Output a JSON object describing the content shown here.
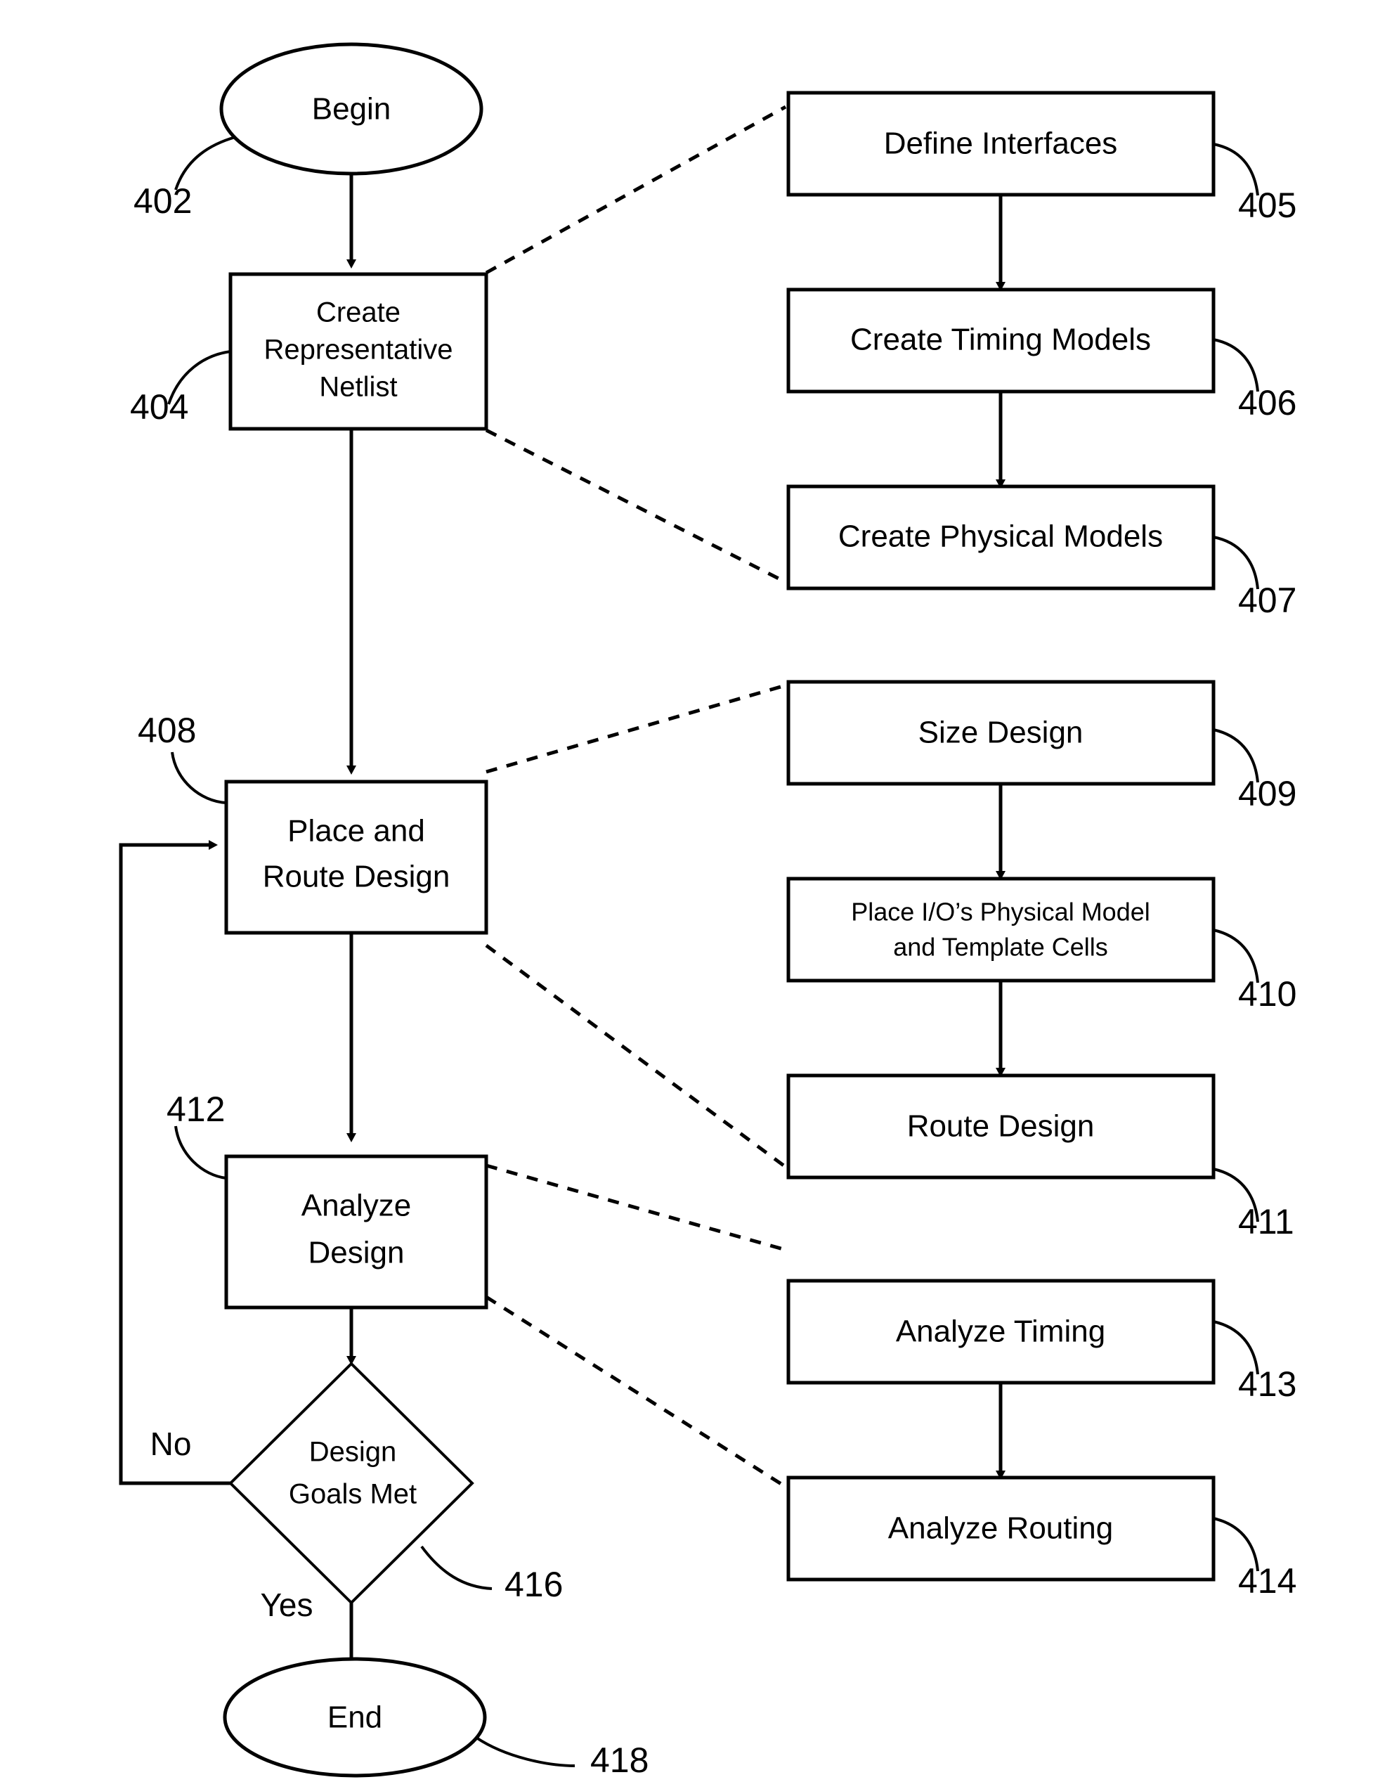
{
  "figure": {
    "type": "flowchart",
    "orientation": "two-column",
    "background_color": "#ffffff",
    "line_color": "#000000"
  },
  "left_column": {
    "begin": {
      "label": "Begin",
      "ref": "402",
      "shape": "ellipse"
    },
    "create_netlist": {
      "line1": "Create",
      "line2": "Representative",
      "line3": "Netlist",
      "ref": "404",
      "shape": "rectangle"
    },
    "place_route": {
      "line1": "Place and",
      "line2": "Route Design",
      "ref": "408",
      "shape": "rectangle"
    },
    "analyze_design": {
      "line1": "Analyze",
      "line2": "Design",
      "ref": "412",
      "shape": "rectangle"
    },
    "decision": {
      "line1": "Design",
      "line2": "Goals Met",
      "ref": "416",
      "shape": "diamond"
    },
    "end": {
      "label": "End",
      "ref": "418",
      "shape": "ellipse"
    },
    "branch_no": "No",
    "branch_yes": "Yes"
  },
  "right_column": {
    "group_netlist": [
      {
        "label": "Define Interfaces",
        "ref": "405"
      },
      {
        "label": "Create Timing Models",
        "ref": "406"
      },
      {
        "label": "Create Physical Models",
        "ref": "407"
      }
    ],
    "group_place_route": [
      {
        "label": "Size Design",
        "ref": "409"
      },
      {
        "line1": "Place I/O’s Physical Model",
        "line2": "and Template Cells",
        "ref": "410"
      },
      {
        "label": "Route Design",
        "ref": "411"
      }
    ],
    "group_analyze": [
      {
        "label": "Analyze Timing",
        "ref": "413"
      },
      {
        "label": "Analyze Routing",
        "ref": "414"
      }
    ]
  }
}
